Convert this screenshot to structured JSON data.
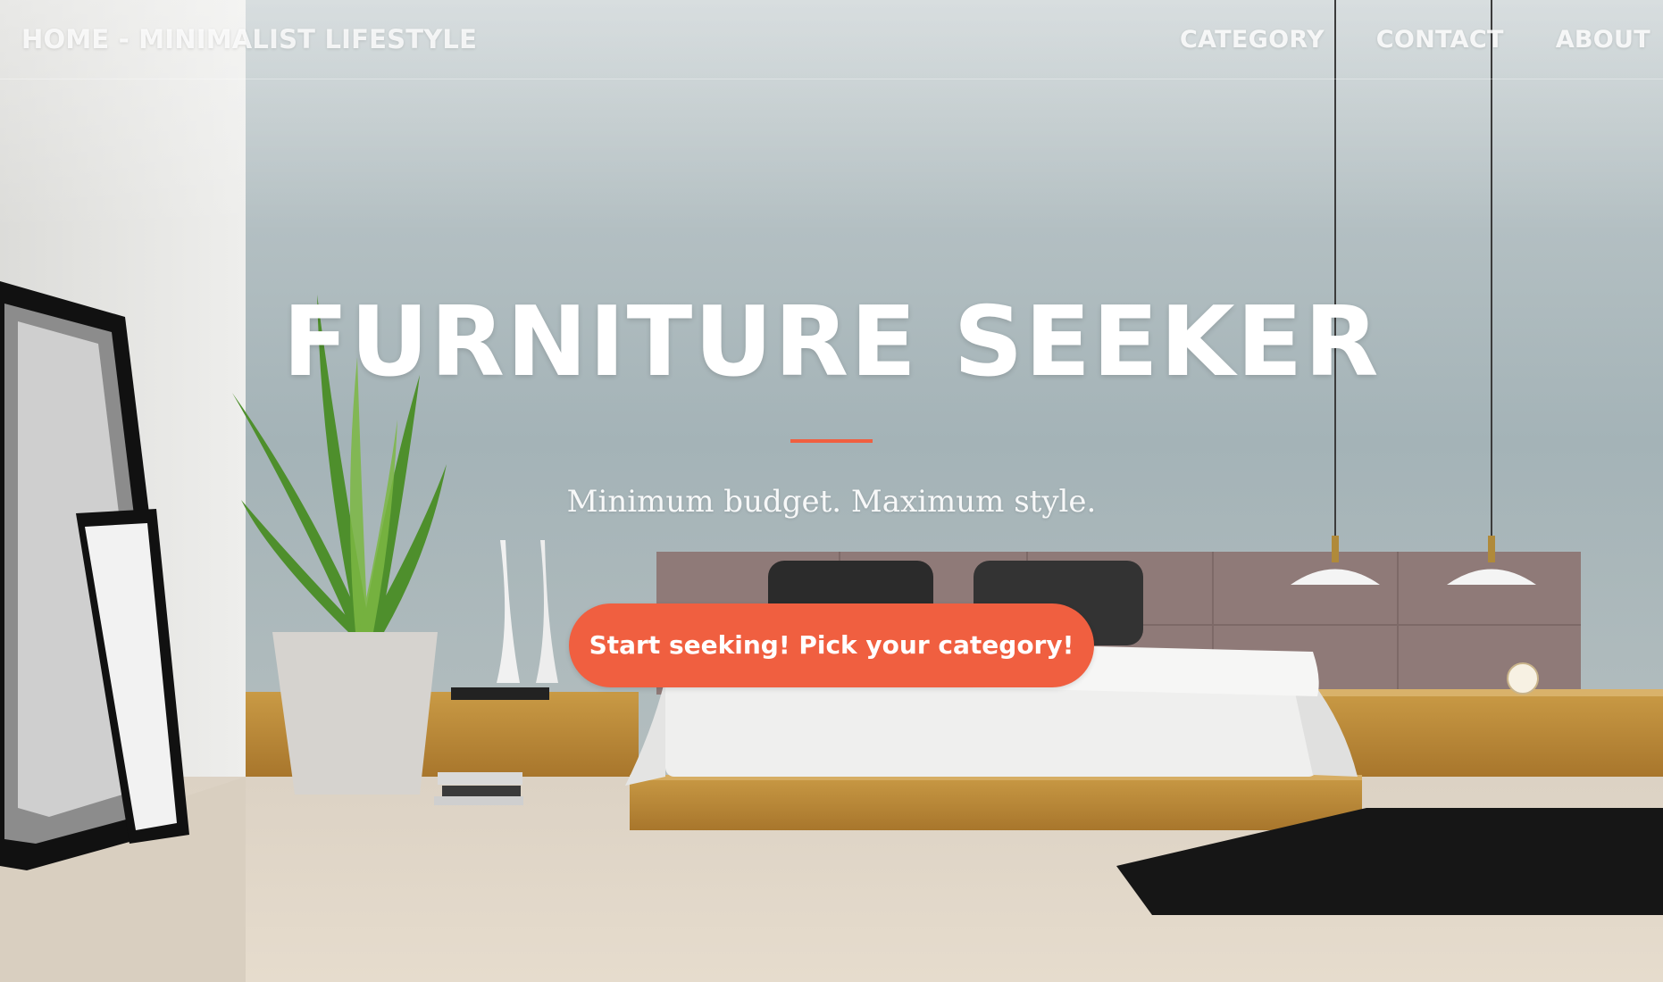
{
  "nav": {
    "brand": "HOME - MINIMALIST LIFESTYLE",
    "links": [
      {
        "label": "CATEGORY"
      },
      {
        "label": "CONTACT"
      },
      {
        "label": "ABOUT"
      }
    ]
  },
  "hero": {
    "title": "FURNITURE SEEKER",
    "tagline": "Minimum budget. Maximum style.",
    "cta_label": "Start seeking! Pick your category!"
  },
  "colors": {
    "accent": "#f05f40",
    "text": "#ffffff",
    "wall": "#a9b7bb"
  }
}
